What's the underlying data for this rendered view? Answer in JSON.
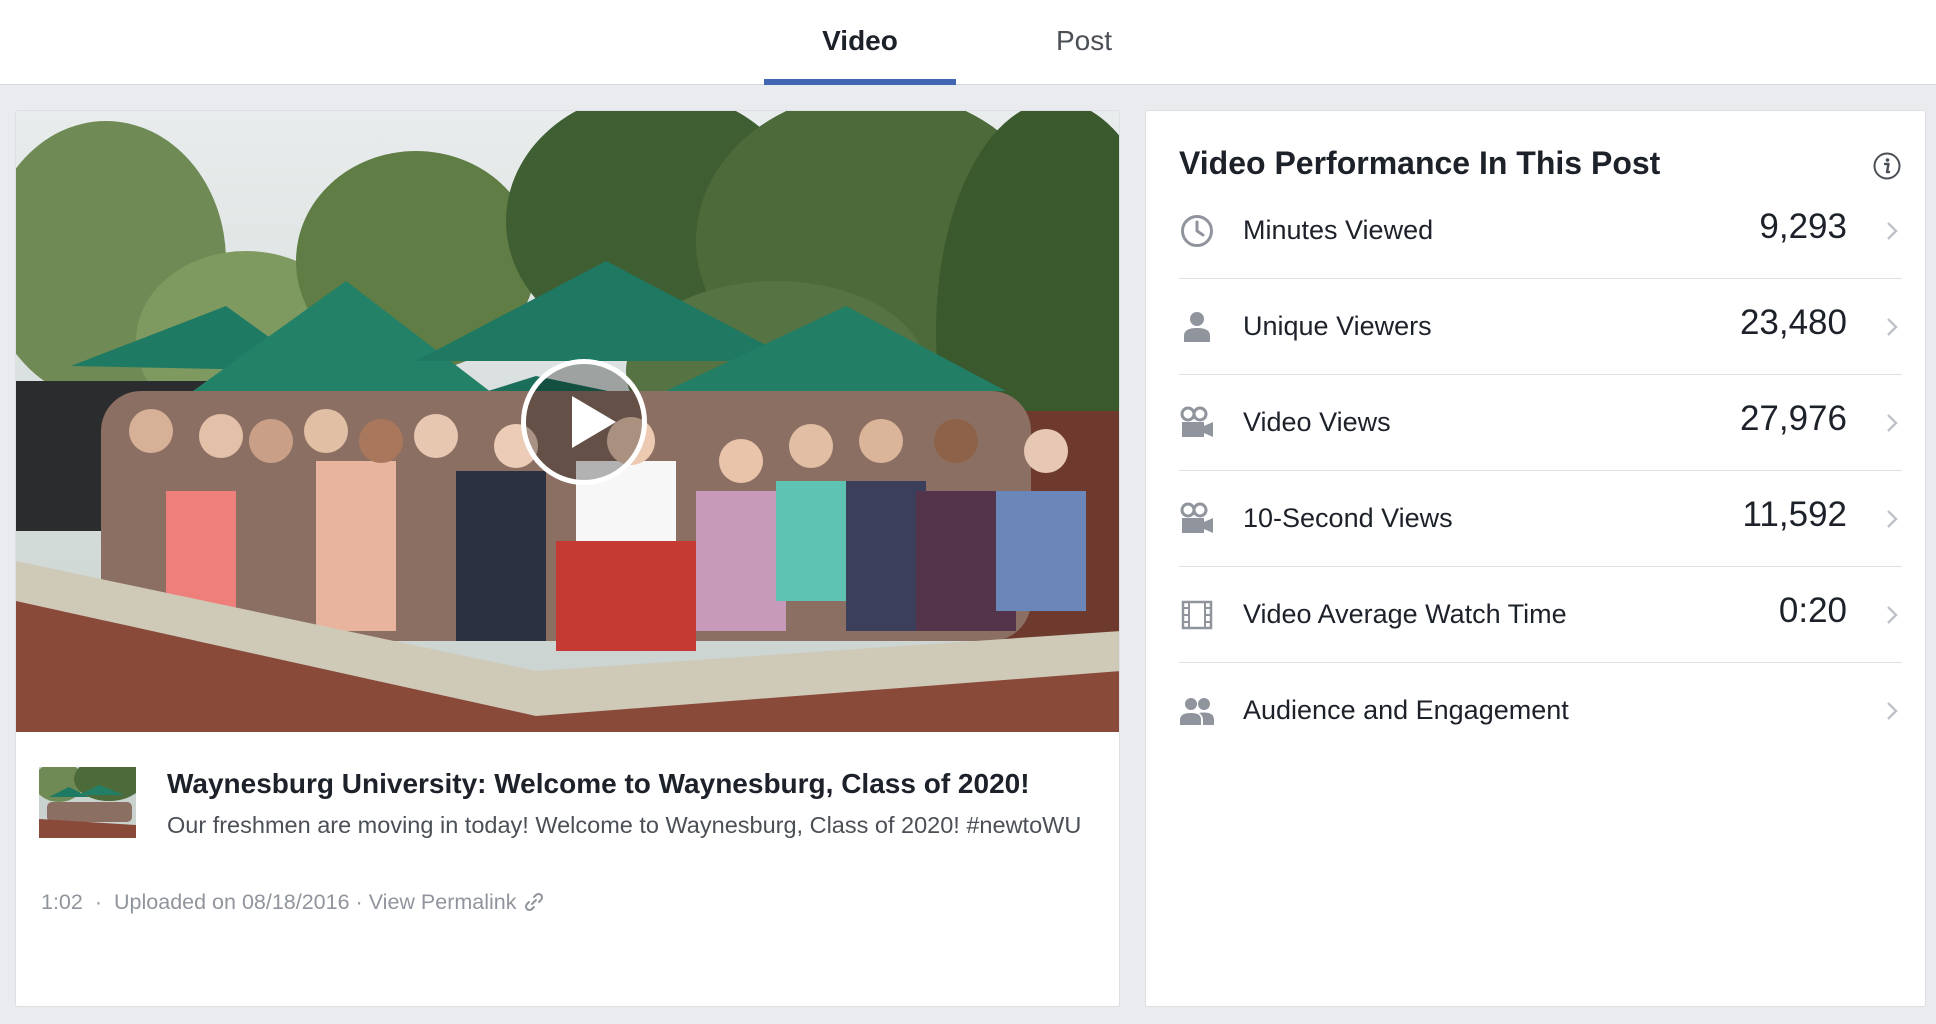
{
  "tabs": [
    {
      "label": "Video",
      "active": true
    },
    {
      "label": "Post",
      "active": false
    }
  ],
  "video": {
    "title": "Waynesburg University: Welcome to Waynesburg, Class of 2020!",
    "description": "Our freshmen are moving in today! Welcome to Waynesburg, Class of 2020! #newtoWU",
    "duration": "1:02",
    "uploaded": "Uploaded on 08/18/2016",
    "permalink_label": "View Permalink",
    "separator": "·"
  },
  "performance": {
    "title": "Video Performance In This Post",
    "metrics": [
      {
        "icon": "clock-icon",
        "label": "Minutes Viewed",
        "value": "9,293"
      },
      {
        "icon": "person-icon",
        "label": "Unique Viewers",
        "value": "23,480"
      },
      {
        "icon": "video-camera-icon",
        "label": "Video Views",
        "value": "27,976"
      },
      {
        "icon": "video-camera-icon",
        "label": "10-Second Views",
        "value": "11,592"
      },
      {
        "icon": "film-strip-icon",
        "label": "Video Average Watch Time",
        "value": "0:20"
      },
      {
        "icon": "people-icon",
        "label": "Audience and Engagement",
        "value": ""
      }
    ]
  },
  "colors": {
    "accent": "#4267b2",
    "background": "#e9ebee",
    "text_primary": "#1d2129",
    "text_secondary": "#4b4f56",
    "text_muted": "#90949c",
    "icon_gray": "#90949c"
  }
}
